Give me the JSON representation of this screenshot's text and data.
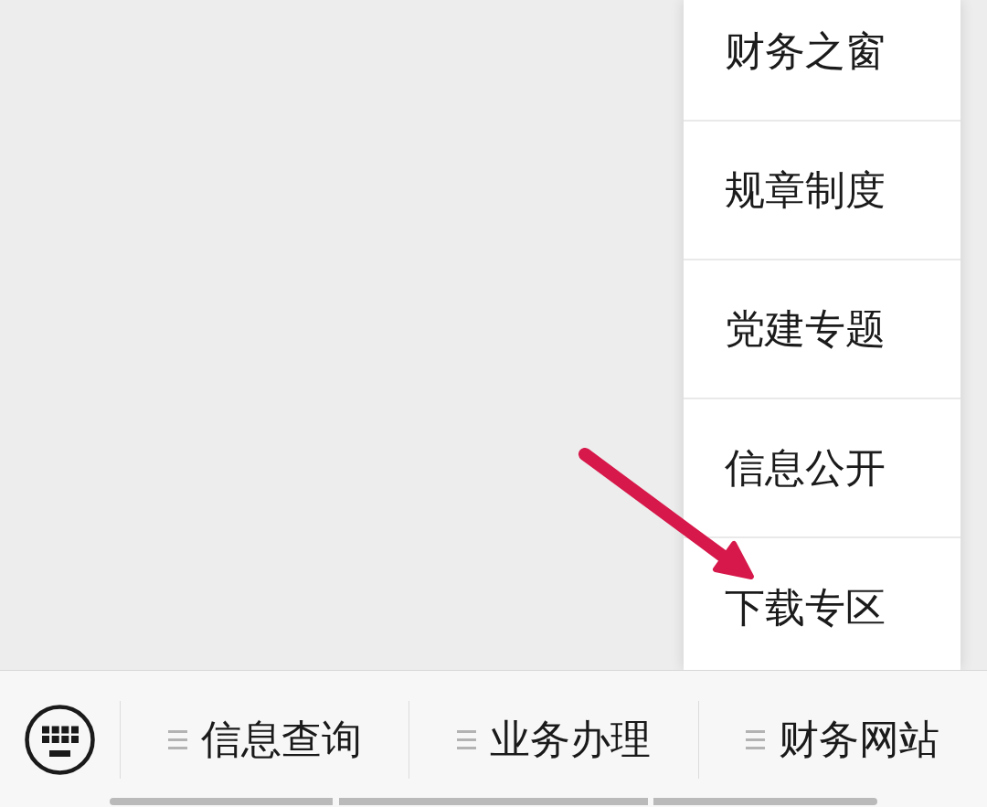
{
  "menu_bar": {
    "buttons": [
      {
        "label": "信息查询"
      },
      {
        "label": "业务办理"
      },
      {
        "label": "财务网站",
        "submenu": [
          {
            "label": "财务之窗",
            "marked": false
          },
          {
            "label": "规章制度",
            "marked": false
          },
          {
            "label": "党建专题",
            "marked": false
          },
          {
            "label": "信息公开",
            "marked": false
          },
          {
            "label": "下载专区",
            "marked": true
          }
        ]
      }
    ]
  }
}
